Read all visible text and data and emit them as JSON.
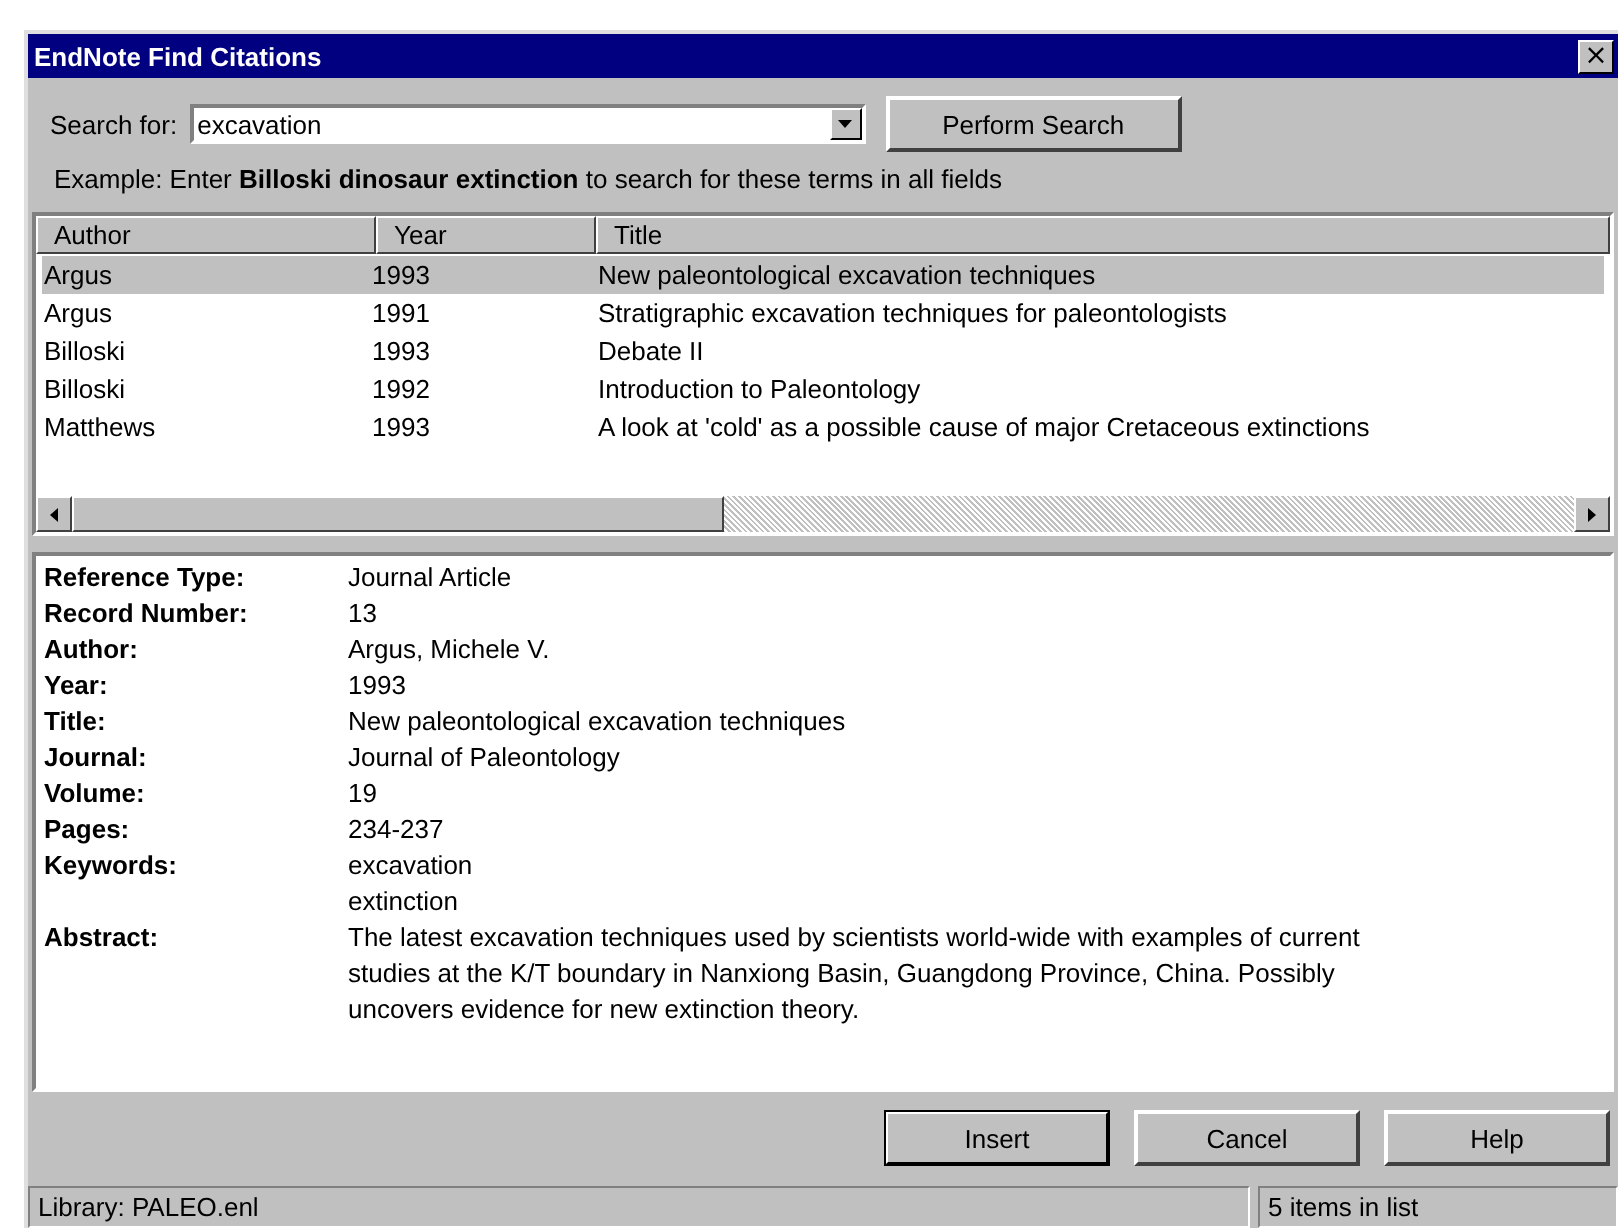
{
  "window": {
    "title": "EndNote Find Citations",
    "close": "×"
  },
  "search": {
    "label": "Search for:",
    "value": "excavation",
    "button": "Perform Search"
  },
  "example": "Example: Enter **Billoski dinosaur extinction** to search for these terms in all fields",
  "table": {
    "columns": [
      "Author",
      "Year",
      "Title"
    ],
    "rows": [
      {
        "cells": [
          "Argus",
          "1993",
          "New paleontological excavation techniques"
        ],
        "selected": true
      },
      {
        "cells": [
          "Argus",
          "1991",
          "Stratigraphic excavation techniques for paleontologists"
        ],
        "selected": false
      },
      {
        "cells": [
          "Billoski",
          "1993",
          "Debate II"
        ],
        "selected": false
      },
      {
        "cells": [
          "Billoski",
          "1992",
          "Introduction to Paleontology"
        ],
        "selected": false
      },
      {
        "cells": [
          "Matthews",
          "1993",
          "A look at 'cold' as a possible cause of major Cretaceous extinctions"
        ],
        "selected": false
      }
    ]
  },
  "details": [
    {
      "label": "Reference Type:",
      "lines": [
        "Journal Article"
      ]
    },
    {
      "label": "Record Number:",
      "lines": [
        "13"
      ]
    },
    {
      "label": "Author:",
      "lines": [
        "Argus, Michele V."
      ]
    },
    {
      "label": "Year:",
      "lines": [
        "1993"
      ]
    },
    {
      "label": "Title:",
      "lines": [
        "New paleontological excavation techniques"
      ]
    },
    {
      "label": "Journal:",
      "lines": [
        "Journal of Paleontology"
      ]
    },
    {
      "label": "Volume:",
      "lines": [
        "19"
      ]
    },
    {
      "label": "Pages:",
      "lines": [
        "234-237"
      ]
    },
    {
      "label": "Keywords:",
      "lines": [
        "excavation",
        "extinction"
      ]
    },
    {
      "label": "Abstract:",
      "lines": [
        "The latest excavation techniques used by scientists world-wide with examples of current",
        "studies at the K/T boundary in Nanxiong Basin, Guangdong Province, China. Possibly",
        "uncovers evidence for new extinction theory."
      ]
    }
  ],
  "buttons": [
    {
      "label": "Insert",
      "default": true
    },
    {
      "label": "Cancel",
      "default": false
    },
    {
      "label": "Help",
      "default": false
    }
  ],
  "status_bar": {
    "library": "Library: PALEO.enl",
    "count": "5 items in list"
  }
}
